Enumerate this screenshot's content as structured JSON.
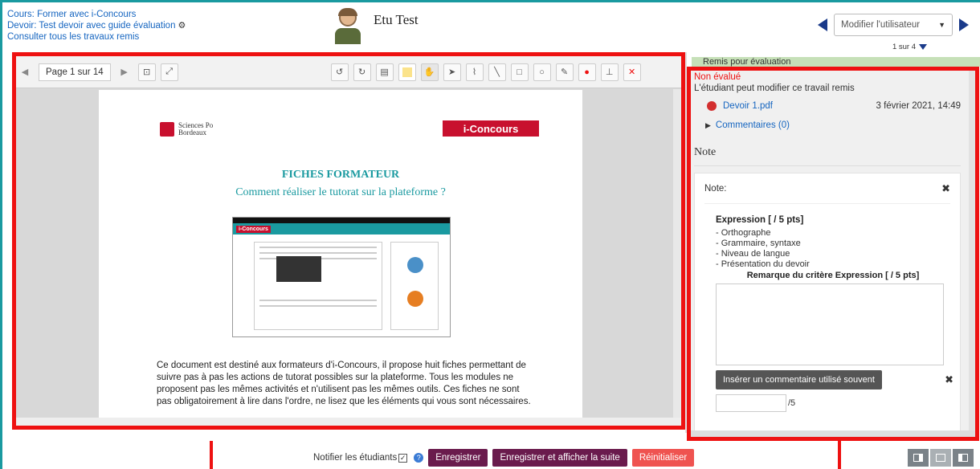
{
  "header": {
    "course_link": "Cours: Former avec i-Concours",
    "assignment_link": "Devoir: Test devoir avec guide évaluation",
    "view_all_link": "Consulter tous les travaux remis",
    "student_name": "Etu Test",
    "user_select": "Modifier l'utilisateur",
    "count": "1 sur 4"
  },
  "toolbar": {
    "page_label": "Page 1 sur 14",
    "icons": [
      "prev-page-icon",
      "next-page-icon",
      "search-icon",
      "expand-icon",
      "rotate-left-icon",
      "rotate-right-icon",
      "comment-icon",
      "highlight-icon",
      "hand-icon",
      "pointer-icon",
      "stamp-icon",
      "line-icon",
      "rectangle-icon",
      "oval-icon",
      "pen-icon",
      "color-icon",
      "stamp-tool-icon",
      "close-icon"
    ]
  },
  "document": {
    "institution": "Sciences Po\nBordeaux",
    "brand": "i-Concours",
    "title": "FICHES FORMATEUR",
    "subtitle": "Comment réaliser le tutorat sur la plateforme ?",
    "thumb_brand": "i-Concours",
    "body": "Ce document est destiné aux formateurs d'i-Concours, il propose huit fiches permettant de suivre pas à pas les actions de tutorat possibles sur la plateforme. Tous les modules ne proposent pas les mêmes activités et n'utilisent pas les mêmes outils. Ces fiches ne sont pas obligatoirement à lire dans l'ordre, ne lisez que les éléments qui vous sont nécessaires."
  },
  "grading": {
    "submitted": "Remis pour évaluation",
    "status": "Non évalué",
    "modifiable": "L'étudiant peut modifier ce travail remis",
    "file_name": "Devoir 1.pdf",
    "file_date": "3 février 2021, 14:49",
    "comments": "Commentaires (0)",
    "note_heading": "Note",
    "note_label": "Note:",
    "criterion_title": "Expression [ / 5 pts]",
    "criterion_items": [
      "- Orthographe",
      "- Grammaire, syntaxe",
      "- Niveau de langue",
      "- Présentation du devoir"
    ],
    "remark_label": "Remarque du critère Expression [ / 5 pts]",
    "insert_button": "Insérer un commentaire utilisé souvent",
    "score_suffix": "/5"
  },
  "footer": {
    "notify_label": "Notifier les étudiants",
    "save_button": "Enregistrer",
    "save_next_button": "Enregistrer et afficher la suite",
    "reset_button": "Réinitialiser"
  },
  "colors": {
    "accent": "#1a9aa0",
    "highlight_border": "#e11111",
    "primary_button": "#6a1b4d",
    "reset_button": "#ef5350",
    "link": "#1565c0"
  }
}
